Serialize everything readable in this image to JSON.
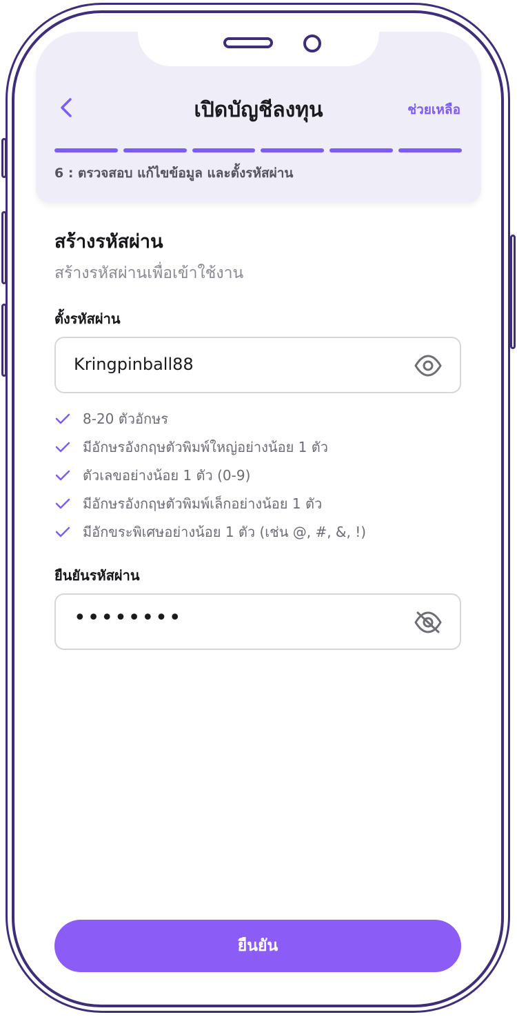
{
  "header": {
    "title": "เปิดบัญชีลงทุน",
    "help_label": "ช่วยเหลือ",
    "back_icon": "chevron-left-icon",
    "progress": {
      "total_steps": 6,
      "completed_steps": 6
    },
    "step_label": "6 : ตรวจสอบ แก้ไขข้อมูล และตั้งรหัสผ่าน"
  },
  "section": {
    "title": "สร้างรหัสผ่าน",
    "subtitle": "สร้างรหัสผ่านเพื่อเข้าใช้งาน"
  },
  "password": {
    "label": "ตั้งรหัสผ่าน",
    "value": "Kringpinball88",
    "toggle_icon": "eye-icon"
  },
  "rules": [
    {
      "text": "8-20 ตัวอักษร",
      "met": true
    },
    {
      "text": "มีอักษรอังกฤษตัวพิมพ์ใหญ่อย่างน้อย 1 ตัว",
      "met": true
    },
    {
      "text": "ตัวเลขอย่างน้อย 1 ตัว (0-9)",
      "met": true
    },
    {
      "text": "มีอักษรอังกฤษตัวพิมพ์เล็กอย่างน้อย 1 ตัว",
      "met": true
    },
    {
      "text": "มีอักขระพิเศษอย่างน้อย 1 ตัว (เช่น @, #, &, !)",
      "met": true
    }
  ],
  "confirm": {
    "label": "ยืนยันรหัสผ่าน",
    "masked_value": "••••••••",
    "toggle_icon": "eye-off-icon"
  },
  "submit_label": "ยืนยัน",
  "colors": {
    "accent": "#8b5cf6",
    "header_bg": "#efedf7",
    "frame": "#3f2d7a",
    "check": "#7c5cf5"
  }
}
